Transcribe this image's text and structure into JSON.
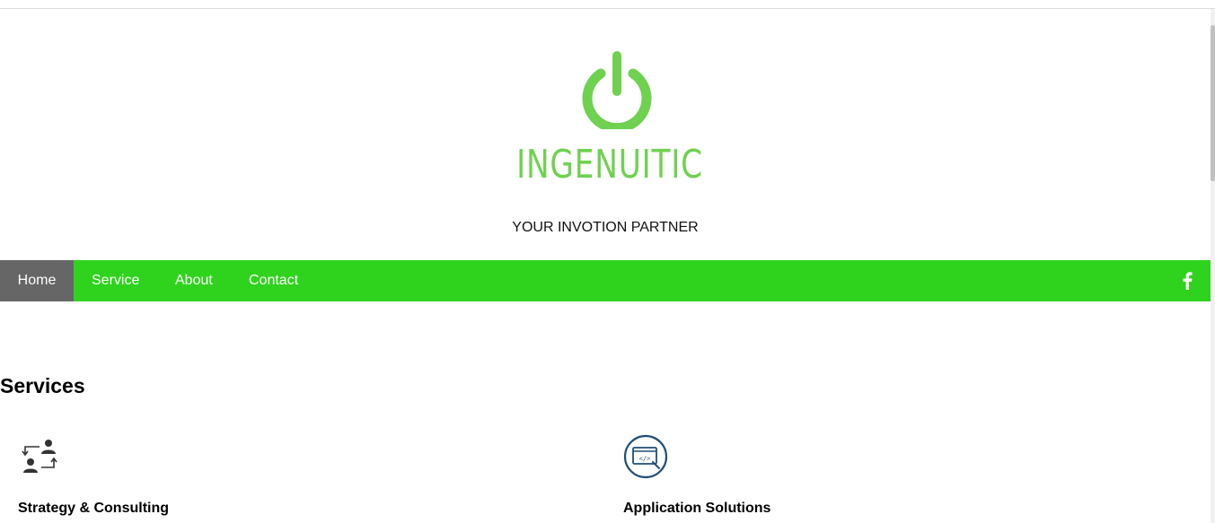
{
  "header": {
    "brand": "INGENUITIC",
    "tagline": "YOUR INVOTION PARTNER",
    "logo_icon": "power-icon",
    "brand_color": "#6fd150"
  },
  "nav": {
    "items": [
      {
        "label": "Home",
        "active": true
      },
      {
        "label": "Service"
      },
      {
        "label": "About"
      },
      {
        "label": "Contact"
      }
    ],
    "social_icon": "facebook-icon",
    "bar_color": "#2fd31d",
    "active_color": "#666666"
  },
  "services": {
    "title": "Services",
    "items": [
      {
        "title": "Strategy & Consulting",
        "icon": "user-exchange-icon"
      },
      {
        "title": "Application Solutions",
        "icon": "code-window-icon"
      }
    ]
  }
}
